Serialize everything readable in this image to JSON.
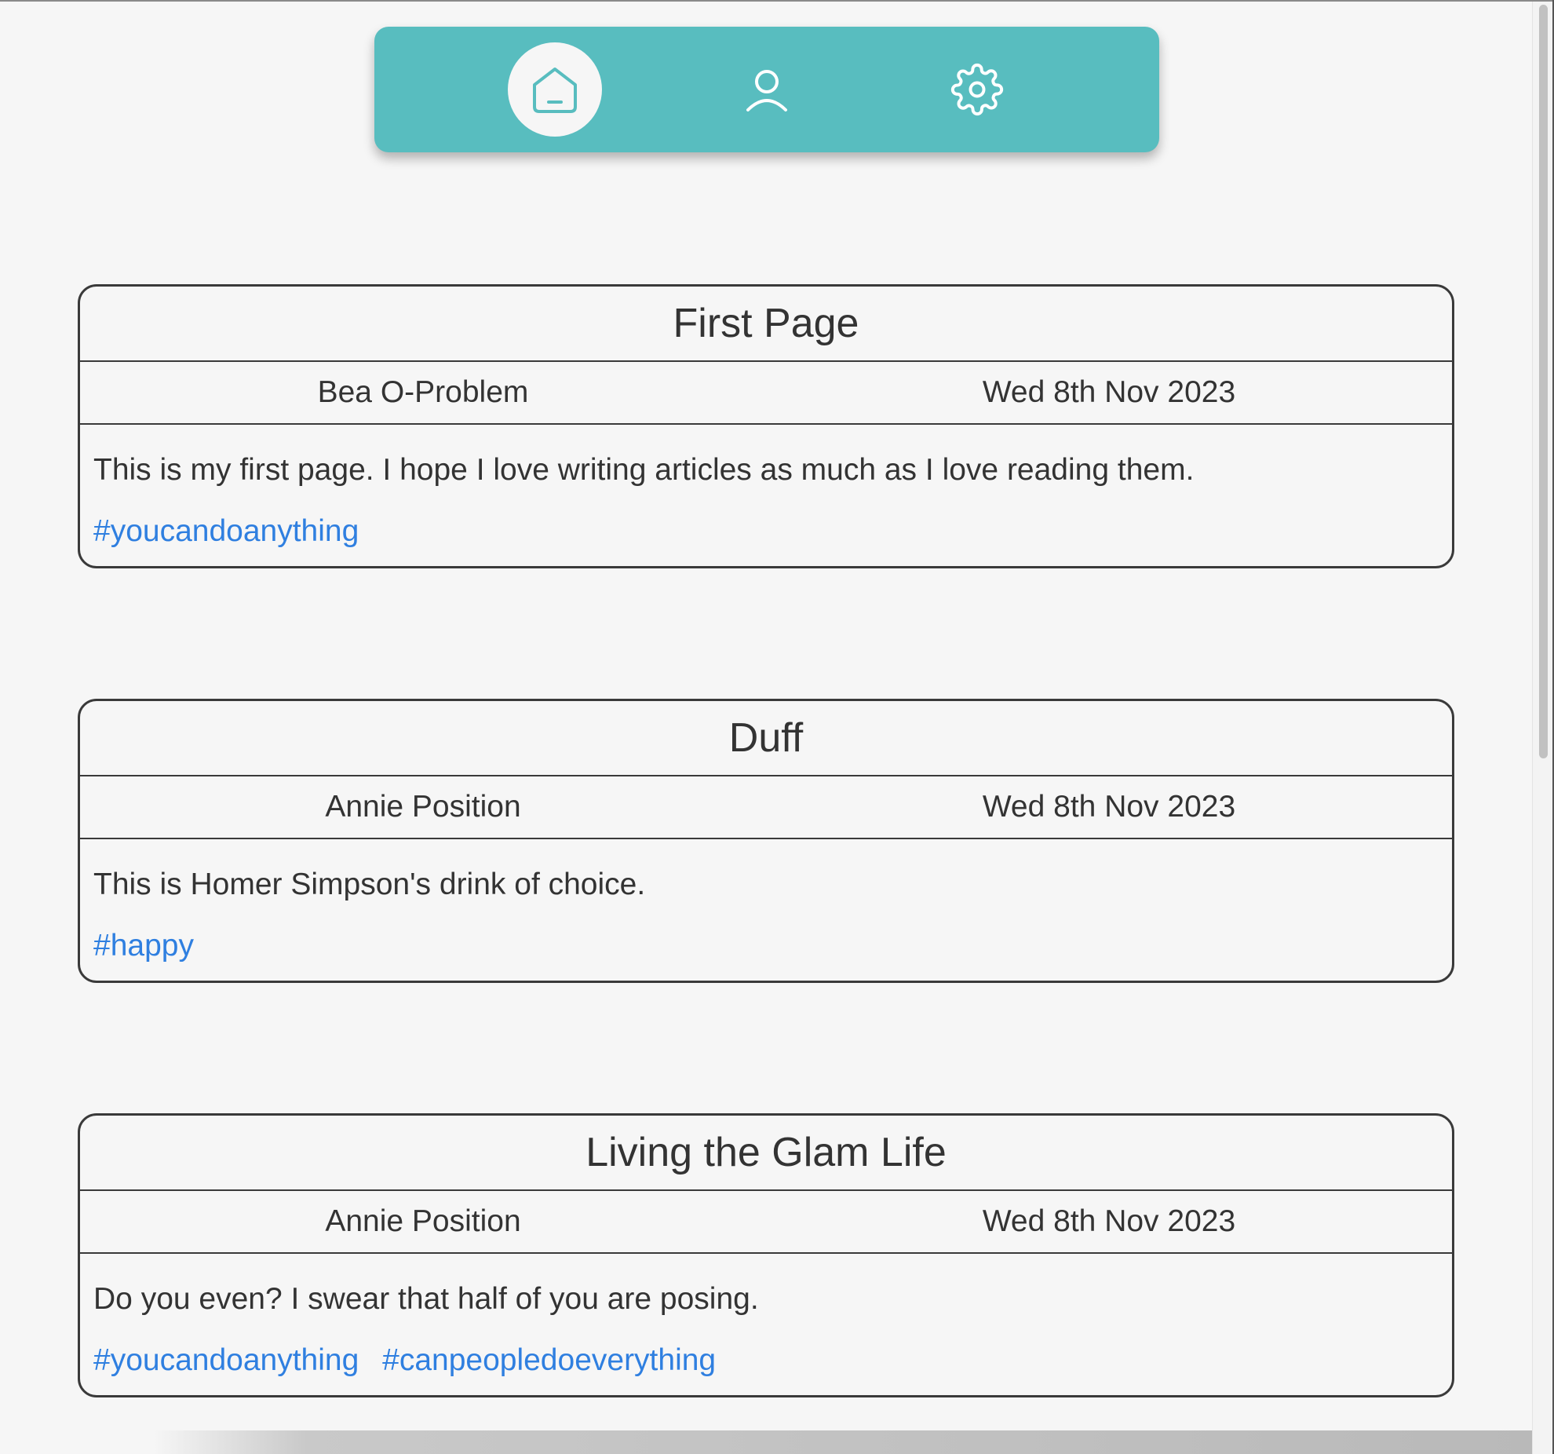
{
  "nav": {
    "items": [
      {
        "label": "Home",
        "icon": "home-icon",
        "active": true
      },
      {
        "label": "Profile",
        "icon": "user-icon",
        "active": false
      },
      {
        "label": "Settings",
        "icon": "gear-icon",
        "active": false
      }
    ]
  },
  "articles": [
    {
      "title": "First Page",
      "author": "Bea O-Problem",
      "date": "Wed 8th Nov 2023",
      "body": "This is my first page. I hope I love writing articles as much as I love reading them.",
      "tags": [
        "#youcandoanything"
      ]
    },
    {
      "title": "Duff",
      "author": "Annie Position",
      "date": "Wed 8th Nov 2023",
      "body": "This is Homer Simpson's drink of choice.",
      "tags": [
        "#happy"
      ]
    },
    {
      "title": "Living the Glam Life",
      "author": "Annie Position",
      "date": "Wed 8th Nov 2023",
      "body": "Do you even? I swear that half of you are posing.",
      "tags": [
        "#youcandoanything",
        "#canpeopledoeverything"
      ]
    }
  ],
  "colors": {
    "nav_background": "#58bdbf",
    "tag_link": "#2f7fe0",
    "text": "#333333",
    "page_background": "#f6f6f6"
  }
}
